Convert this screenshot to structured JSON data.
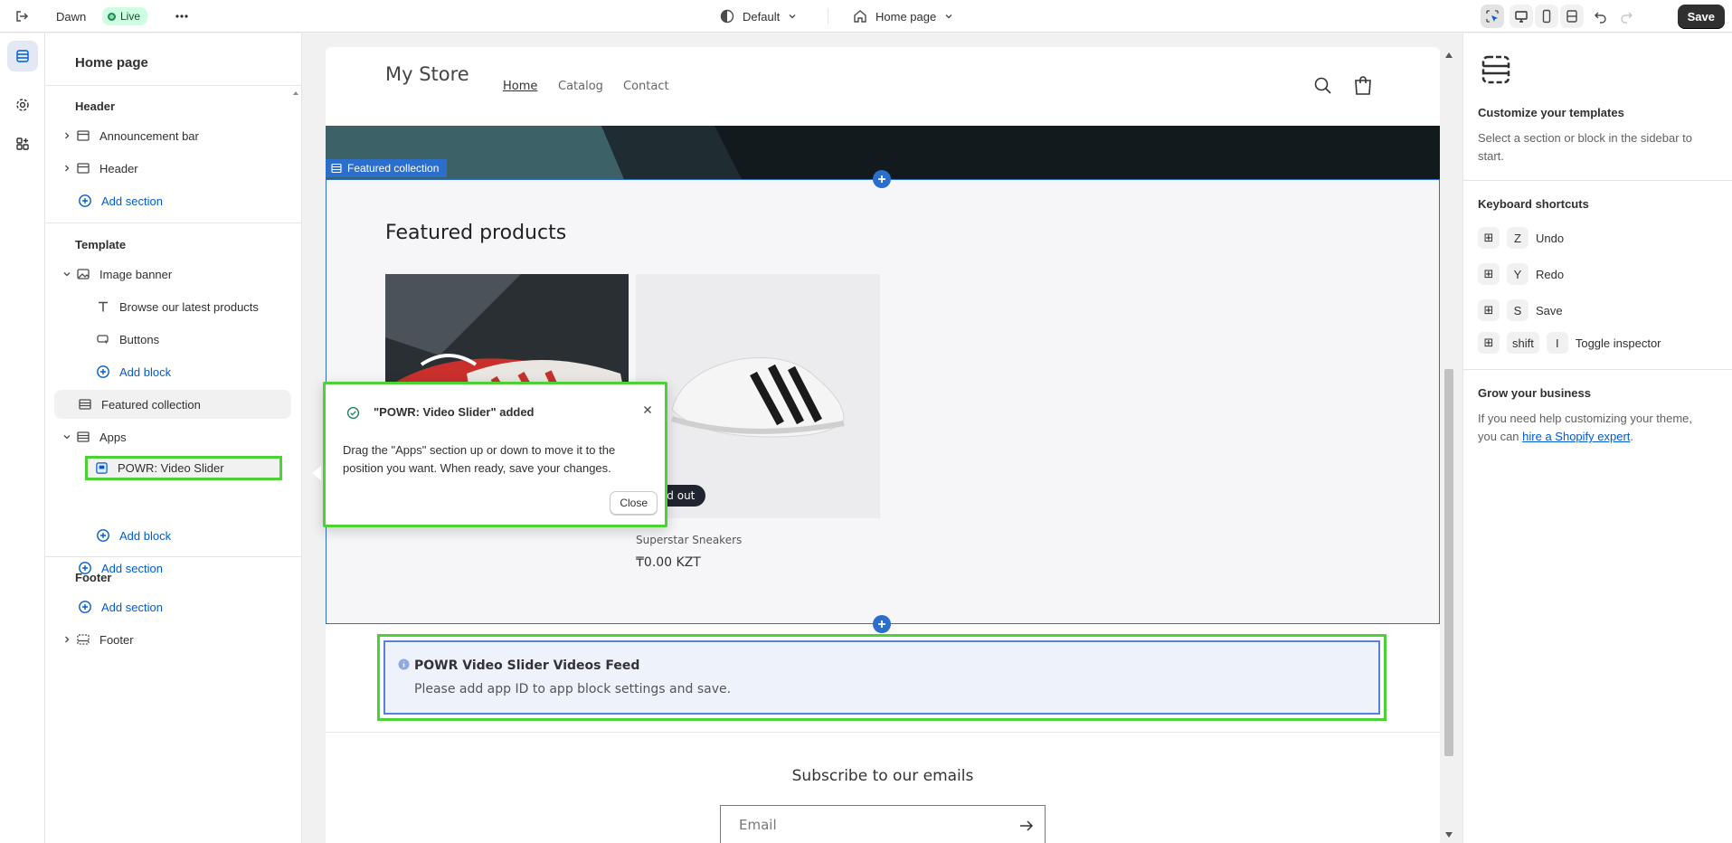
{
  "topbar": {
    "theme_name": "Dawn",
    "live_label": "Live",
    "theme_select": "Default",
    "page_select": "Home page",
    "save_label": "Save"
  },
  "sidebar": {
    "title": "Home page",
    "header_group": "Header",
    "announcement_bar": "Announcement bar",
    "header_item": "Header",
    "add_section": "Add section",
    "template_group": "Template",
    "image_banner": "Image banner",
    "browse_block": "Browse our latest products",
    "buttons_block": "Buttons",
    "add_block": "Add block",
    "featured_collection": "Featured collection",
    "apps": "Apps",
    "powr_slider": "POWR: Video Slider",
    "footer_group": "Footer",
    "footer_item": "Footer"
  },
  "store": {
    "name": "My Store",
    "nav": [
      "Home",
      "Catalog",
      "Contact"
    ],
    "section_tag": "Featured collection",
    "featured_title": "Featured products",
    "product2_name": "Superstar Sneakers",
    "product2_price": "₸0.00 KZT",
    "sold_out": "Sold out",
    "app_title": "POWR Video Slider Videos Feed",
    "app_msg": "Please add app ID to app block settings and save.",
    "subscribe_title": "Subscribe to our emails",
    "email_placeholder": "Email"
  },
  "toast": {
    "title": "\"POWR: Video Slider\" added",
    "body": "Drag the \"Apps\" section up or down to move it to the position you want. When ready, save your changes.",
    "close_label": "Close"
  },
  "rightpanel": {
    "customize_title": "Customize your templates",
    "customize_text": "Select a section or block in the sidebar to start.",
    "shortcuts_title": "Keyboard shortcuts",
    "shortcuts": [
      {
        "key": "Z",
        "label": "Undo"
      },
      {
        "key": "Y",
        "label": "Redo"
      },
      {
        "key": "S",
        "label": "Save"
      },
      {
        "key": "shift",
        "key2": "I",
        "label": "Toggle inspector"
      }
    ],
    "grow_title": "Grow your business",
    "grow_text": "If you need help customizing your theme, you can ",
    "grow_link": "hire a Shopify expert",
    "grow_end": "."
  },
  "colors": {
    "accent": "#005bd3",
    "highlight": "#4cd137",
    "live": "#cdfee1"
  }
}
